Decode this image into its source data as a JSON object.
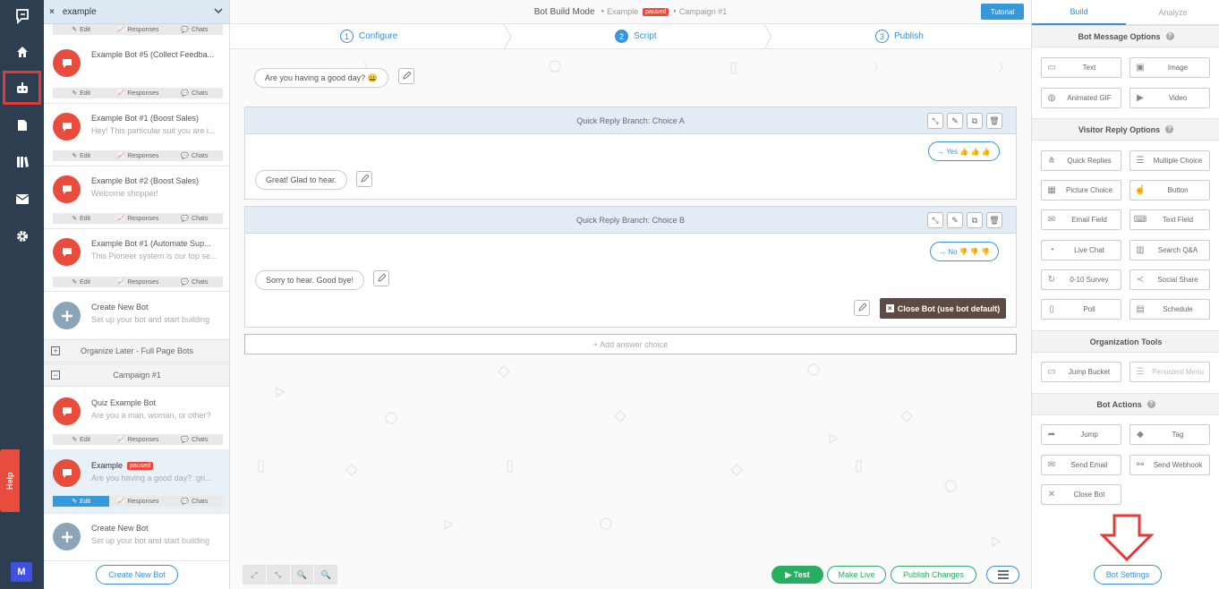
{
  "nav": {
    "items": [
      {
        "name": "logo-icon"
      },
      {
        "name": "home-icon"
      },
      {
        "name": "bot-icon",
        "active": true
      },
      {
        "name": "document-icon"
      },
      {
        "name": "library-icon"
      },
      {
        "name": "mail-icon"
      },
      {
        "name": "gear-icon"
      }
    ],
    "help_label": "Help",
    "avatar_letter": "M"
  },
  "bot_list": {
    "search_value": "example",
    "actions": {
      "edit": "Edit",
      "responses": "Responses",
      "chats": "Chats"
    },
    "bots": [
      {
        "title": "Example Bot #5 (Collect Feedba...",
        "subtitle": ""
      },
      {
        "title": "Example Bot #1 (Boost Sales)",
        "subtitle": "Hey! This particular suit you are i..."
      },
      {
        "title": "Example Bot #2 (Boost Sales)",
        "subtitle": "Welcome shopper!"
      },
      {
        "title": "Example Bot #1 (Automate Sup...",
        "subtitle": "This Pioneer system is our top se..."
      }
    ],
    "create_new": {
      "title": "Create New Bot",
      "subtitle": "Set up your bot and start building"
    },
    "groups": [
      {
        "label": "Organize Later - Full Page Bots",
        "toggle": "+"
      },
      {
        "label": "Campaign #1",
        "toggle": "−"
      }
    ],
    "campaign_bots": [
      {
        "title": "Quiz Example Bot",
        "subtitle": "Are you a man, woman, or other?"
      },
      {
        "title": "Example",
        "badge": "paused",
        "subtitle": "Are you having a good day? :gri..."
      }
    ],
    "create_button": "Create New Bot"
  },
  "header": {
    "mode": "Bot Build Mode",
    "bot_name": "Example",
    "status": "paused",
    "campaign": "Campaign #1",
    "tutorial": "Tutorial",
    "sep": "●"
  },
  "steps": [
    {
      "num": "1",
      "label": "Configure"
    },
    {
      "num": "2",
      "label": "Script",
      "active": true
    },
    {
      "num": "3",
      "label": "Publish"
    }
  ],
  "script": {
    "first_message": "Are you having a good day? 😀",
    "branches": [
      {
        "title": "Quick Reply Branch: Choice A",
        "choice": "→ Yes 👍 👍 👍",
        "reply": "Great! Glad to hear."
      },
      {
        "title": "Quick Reply Branch: Choice B",
        "choice": "→ No 👎 👎 👎",
        "reply": "Sorry to hear. Good bye!"
      }
    ],
    "close_bot": "Close Bot (use bot default)",
    "add_answer": "+ Add answer choice"
  },
  "bottom": {
    "test": "▶ Test",
    "make_live": "Make Live",
    "publish": "Publish Changes",
    "zoom_icons": [
      "⤢",
      "⤡",
      "🔍",
      "🔍"
    ]
  },
  "sidebar": {
    "tabs": [
      "Build",
      "Analyze"
    ],
    "sections": [
      {
        "title": "Bot Message Options",
        "help": true,
        "tools": [
          {
            "label": "Text",
            "icon": "text-icon"
          },
          {
            "label": "Image",
            "icon": "image-icon"
          },
          {
            "label": "Animated GIF",
            "icon": "gif-icon"
          },
          {
            "label": "Video",
            "icon": "video-icon"
          }
        ]
      },
      {
        "title": "Visitor Reply Options",
        "help": true,
        "tools": [
          {
            "label": "Quick Replies",
            "icon": "quick-replies-icon"
          },
          {
            "label": "Multiple Choice",
            "icon": "multiple-choice-icon"
          },
          {
            "label": "Picture Choice",
            "icon": "picture-choice-icon"
          },
          {
            "label": "Button",
            "icon": "button-icon"
          },
          {
            "label": "Email Field",
            "icon": "email-field-icon"
          },
          {
            "label": "Text Field",
            "icon": "text-field-icon"
          },
          {
            "label": "Live Chat",
            "icon": "live-chat-icon"
          },
          {
            "label": "Search Q&A",
            "icon": "search-qa-icon"
          },
          {
            "label": "0-10 Survey",
            "icon": "survey-icon"
          },
          {
            "label": "Social Share",
            "icon": "share-icon"
          },
          {
            "label": "Poll",
            "icon": "poll-icon"
          },
          {
            "label": "Schedule",
            "icon": "schedule-icon"
          }
        ]
      },
      {
        "title": "Organization Tools",
        "help": false,
        "tools": [
          {
            "label": "Jump Bucket",
            "icon": "jump-bucket-icon"
          },
          {
            "label": "Persistent Menu",
            "icon": "menu-icon",
            "disabled": true
          }
        ]
      },
      {
        "title": "Bot Actions",
        "help": true,
        "tools": [
          {
            "label": "Jump",
            "icon": "jump-icon"
          },
          {
            "label": "Tag",
            "icon": "tag-icon"
          },
          {
            "label": "Send Email",
            "icon": "send-email-icon"
          },
          {
            "label": "Send Webhook",
            "icon": "webhook-icon"
          },
          {
            "label": "Close Bot",
            "icon": "close-icon"
          }
        ]
      }
    ],
    "bot_settings": "Bot Settings"
  }
}
